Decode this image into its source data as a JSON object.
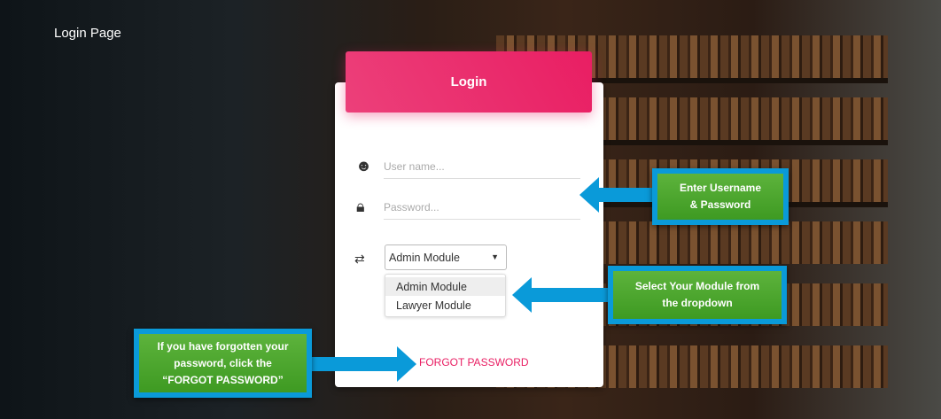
{
  "page_title": "Login Page",
  "login": {
    "header": "Login",
    "username_placeholder": "User name...",
    "password_placeholder": "Password...",
    "module_select": {
      "value": "Admin Module",
      "options": [
        "Admin Module",
        "Lawyer Module"
      ]
    },
    "forgot_password": "FORGOT PASSWORD"
  },
  "callouts": {
    "credentials": [
      "Enter Username",
      "& Password"
    ],
    "module": [
      "Select Your Module from",
      "the dropdown"
    ],
    "forgot": [
      "If you have forgotten your",
      "password, click the",
      "“FORGOT PASSWORD”"
    ]
  },
  "colors": {
    "accent": "#e91e63",
    "callout_border": "#0a9ad9",
    "callout_fill": "#4aa52c"
  }
}
